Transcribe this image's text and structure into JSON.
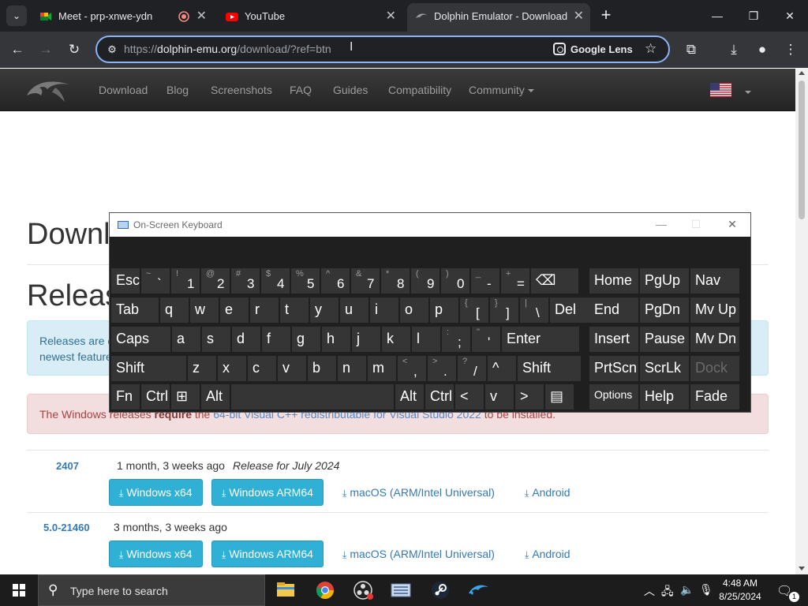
{
  "browser": {
    "tabs": [
      {
        "title": "Meet - prp-xnwe-ydn"
      },
      {
        "title": "YouTube"
      },
      {
        "title": "Dolphin Emulator - Download"
      }
    ],
    "url_scheme": "https://",
    "url_host": "dolphin-emu.org",
    "url_path": "/download/?ref=btn",
    "lens_label": "Google Lens"
  },
  "site": {
    "nav": [
      "Download",
      "Blog",
      "Screenshots",
      "FAQ",
      "Guides",
      "Compatibility",
      "Community"
    ],
    "heading_download": "Downl",
    "heading_releases": "Releas",
    "info_line1": "Releases are c",
    "info_line2": "newest feature",
    "danger_pre": "The Windows releases ",
    "danger_bold": "require",
    "danger_mid": " the ",
    "danger_link": "64-bit Visual C++ redistributable for Visual Studio 2022",
    "danger_post": " to be installed."
  },
  "releases": [
    {
      "version": "2407",
      "date": "1 month, 3 weeks ago",
      "description": "Release for July 2024",
      "buttons": [
        "Windows x64",
        "Windows ARM64"
      ],
      "links": [
        "macOS (ARM/Intel Universal)",
        "Android"
      ]
    },
    {
      "version": "5.0-21460",
      "date": "3 months, 3 weeks ago",
      "description": "",
      "buttons": [
        "Windows x64",
        "Windows ARM64"
      ],
      "links": [
        "macOS (ARM/Intel Universal)",
        "Android"
      ]
    }
  ],
  "osk": {
    "title": "On-Screen Keyboard",
    "rows": [
      [
        {
          "m": "Esc"
        },
        {
          "s": "~",
          "c": "`"
        },
        {
          "s": "!",
          "c": "1"
        },
        {
          "s": "@",
          "c": "2"
        },
        {
          "s": "#",
          "c": "3"
        },
        {
          "s": "$",
          "c": "4"
        },
        {
          "s": "%",
          "c": "5"
        },
        {
          "s": "^",
          "c": "6"
        },
        {
          "s": "&",
          "c": "7"
        },
        {
          "s": "*",
          "c": "8"
        },
        {
          "s": "(",
          "c": "9"
        },
        {
          "s": ")",
          "c": "0"
        },
        {
          "s": "_",
          "c": "-"
        },
        {
          "s": "+",
          "c": "="
        },
        {
          "m": "⌫"
        },
        {
          "m": "Home"
        },
        {
          "m": "PgUp"
        },
        {
          "m": "Nav"
        }
      ],
      [
        {
          "m": "Tab"
        },
        {
          "m": "q"
        },
        {
          "m": "w"
        },
        {
          "m": "e"
        },
        {
          "m": "r"
        },
        {
          "m": "t"
        },
        {
          "m": "y"
        },
        {
          "m": "u"
        },
        {
          "m": "i"
        },
        {
          "m": "o"
        },
        {
          "m": "p"
        },
        {
          "s": "{",
          "c": "["
        },
        {
          "s": "}",
          "c": "]"
        },
        {
          "s": "|",
          "c": "\\"
        },
        {
          "m": "Del"
        },
        {
          "m": "End"
        },
        {
          "m": "PgDn"
        },
        {
          "m": "Mv Up"
        }
      ],
      [
        {
          "m": "Caps"
        },
        {
          "m": "a"
        },
        {
          "m": "s"
        },
        {
          "m": "d"
        },
        {
          "m": "f"
        },
        {
          "m": "g"
        },
        {
          "m": "h"
        },
        {
          "m": "j"
        },
        {
          "m": "k"
        },
        {
          "m": "l"
        },
        {
          "s": ":",
          "c": ";"
        },
        {
          "s": "\"",
          "c": "'"
        },
        {
          "m": "Enter"
        },
        {
          "m": "Insert"
        },
        {
          "m": "Pause"
        },
        {
          "m": "Mv Dn"
        }
      ],
      [
        {
          "m": "Shift"
        },
        {
          "m": "z"
        },
        {
          "m": "x"
        },
        {
          "m": "c"
        },
        {
          "m": "v"
        },
        {
          "m": "b"
        },
        {
          "m": "n"
        },
        {
          "m": "m"
        },
        {
          "s": "<",
          "c": ","
        },
        {
          "s": ">",
          "c": "."
        },
        {
          "s": "?",
          "c": "/"
        },
        {
          "m": "^"
        },
        {
          "m": "Shift"
        },
        {
          "m": "PrtScn"
        },
        {
          "m": "ScrLk"
        },
        {
          "m": "Dock"
        }
      ],
      [
        {
          "m": "Fn"
        },
        {
          "m": "Ctrl"
        },
        {
          "m": "⊞"
        },
        {
          "m": "Alt"
        },
        {
          "m": ""
        },
        {
          "m": "Alt"
        },
        {
          "m": "Ctrl"
        },
        {
          "m": "<"
        },
        {
          "m": "v"
        },
        {
          "m": ">"
        },
        {
          "m": "▤"
        },
        {
          "m": "Options"
        },
        {
          "m": "Help"
        },
        {
          "m": "Fade"
        }
      ]
    ]
  },
  "taskbar": {
    "search_placeholder": "Type here to search",
    "time": "4:48 AM",
    "date": "8/25/2024",
    "notification_count": "1"
  }
}
